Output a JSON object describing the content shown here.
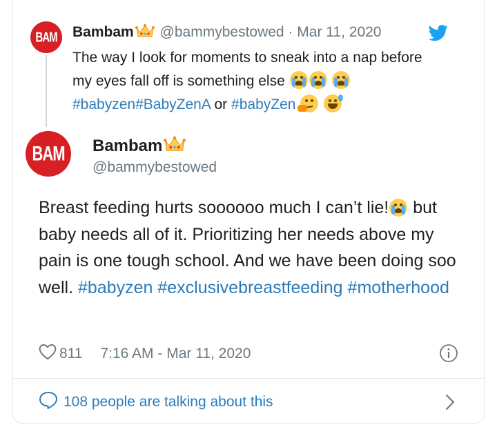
{
  "quoted": {
    "avatar_text": "BAM",
    "name": "Bambam",
    "handle": "@bammybestowed",
    "separator": "·",
    "date": "Mar 11, 2020",
    "text_main": "The way I look for moments to sneak into a nap before my eyes fall off is something else",
    "hashtags_1": "#babyzen#BabyZenA",
    "connector": "or",
    "hashtag_2": "#babyZen"
  },
  "main": {
    "avatar_text": "BAM",
    "name": "Bambam",
    "handle": "@bammybestowed",
    "text_1": "Breast feeding hurts soooooo much I can’t lie!",
    "text_2": "but baby needs all of it. Prioritizing her needs above my pain is one tough school. And we have been doing soo well.",
    "hashtag_1": "#babyzen",
    "hashtag_2": "#exclusivebreastfeeding",
    "hashtag_3": "#motherhood"
  },
  "meta": {
    "likes": "811",
    "timestamp": "7:16 AM - Mar 11, 2020"
  },
  "footer": {
    "talking": "108 people are talking about this"
  },
  "icons": {
    "bird": "twitter-bird-icon",
    "crown": "crown-icon",
    "heart": "heart-icon",
    "info": "info-icon",
    "speech": "speech-bubble-icon",
    "chevron": "chevron-right-icon"
  },
  "colors": {
    "link": "#2b7bb9",
    "muted": "#697882",
    "avatar": "#d71f26",
    "bird": "#1da1f2"
  }
}
